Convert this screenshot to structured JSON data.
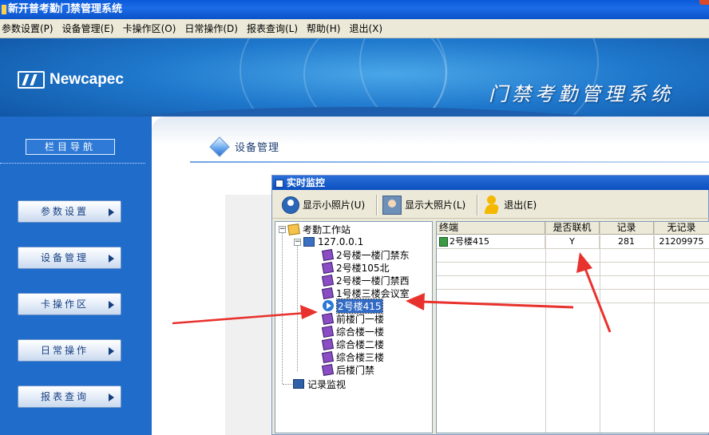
{
  "window": {
    "title": "新开普考勤门禁管理系统"
  },
  "menubar": [
    "参数设置(P)",
    "设备管理(E)",
    "卡操作区(O)",
    "日常操作(D)",
    "报表查询(L)",
    "帮助(H)",
    "退出(X)"
  ],
  "banner": {
    "logo": "Newcapec",
    "system_title": "门禁考勤管理系统"
  },
  "nav": {
    "header": "栏目导航",
    "buttons": [
      "参数设置",
      "设备管理",
      "卡操作区",
      "日常操作",
      "报表查询"
    ]
  },
  "breadcrumb": "设备管理",
  "monitor": {
    "title": "实时监控",
    "toolbar": {
      "small_photo": "显示小照片(U)",
      "large_photo": "显示大照片(L)",
      "exit": "退出(E)"
    },
    "tree": {
      "root": "考勤工作站",
      "ip": "127.0.0.1",
      "devices": [
        "2号楼一楼门禁东",
        "2号楼105北",
        "2号楼一楼门禁西",
        "1号楼三楼会议室",
        "2号楼415",
        "前楼门一楼",
        "综合楼一楼",
        "综合楼二楼",
        "综合楼三楼",
        "后楼门禁"
      ],
      "selected": "2号楼415",
      "record_monitor": "记录监视"
    },
    "grid": {
      "columns": [
        "终端",
        "是否联机",
        "记录",
        "无记录"
      ],
      "rows": [
        {
          "terminal": "2号楼415",
          "online": "Y",
          "records": "281",
          "no_record": "21209975"
        }
      ]
    }
  },
  "colors": {
    "titlebar": "#0a5ad8",
    "nav_bg": "#1f6ccb",
    "annotation_arrow": "#e8322d"
  }
}
